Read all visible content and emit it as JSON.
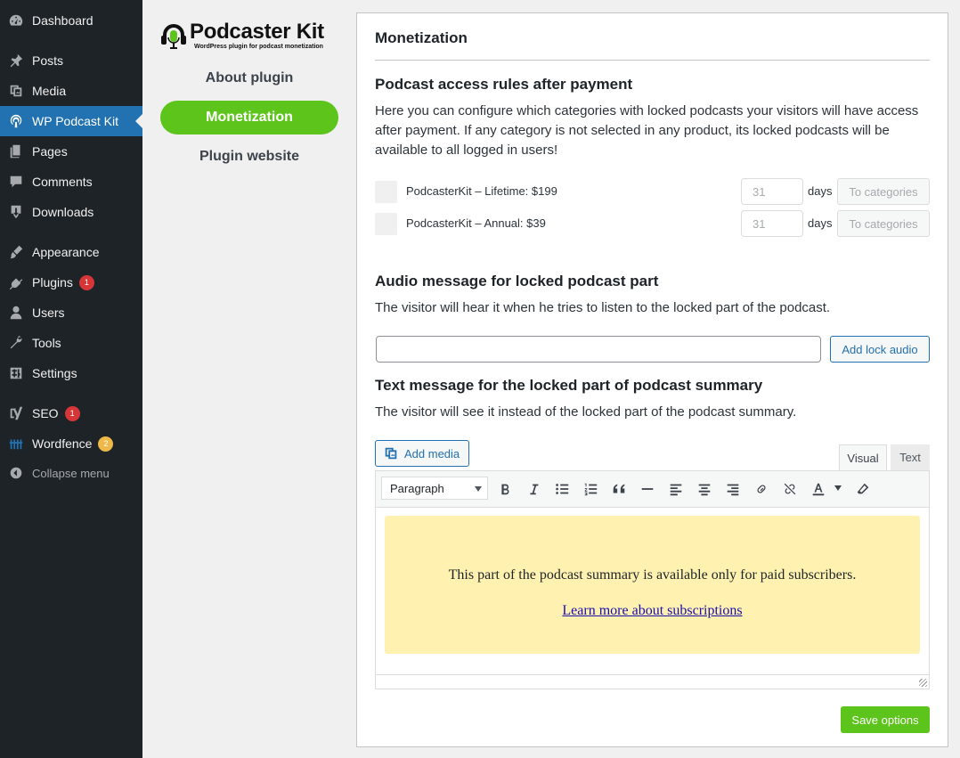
{
  "sidebar": {
    "items": [
      {
        "label": "Dashboard",
        "icon": "dashboard-icon"
      },
      {
        "label": "Posts",
        "icon": "pin-icon"
      },
      {
        "label": "Media",
        "icon": "media-icon"
      },
      {
        "label": "WP Podcast Kit",
        "icon": "podcast-icon",
        "current": true
      },
      {
        "label": "Pages",
        "icon": "pages-icon"
      },
      {
        "label": "Comments",
        "icon": "comments-icon"
      },
      {
        "label": "Downloads",
        "icon": "downloads-icon"
      },
      {
        "label": "Appearance",
        "icon": "appearance-icon"
      },
      {
        "label": "Plugins",
        "icon": "plugins-icon",
        "badge": "1"
      },
      {
        "label": "Users",
        "icon": "users-icon"
      },
      {
        "label": "Tools",
        "icon": "tools-icon"
      },
      {
        "label": "Settings",
        "icon": "settings-icon"
      },
      {
        "label": "SEO",
        "icon": "yoast-icon",
        "badge": "1"
      },
      {
        "label": "Wordfence",
        "icon": "wordfence-icon",
        "badge": "2"
      }
    ],
    "collapse_label": "Collapse menu"
  },
  "plugin_nav": {
    "logo_title": "Podcaster Kit",
    "logo_subtitle": "WordPress plugin for podcast monetization",
    "links": [
      "About plugin",
      "Monetization",
      "Plugin website"
    ],
    "active": "Monetization"
  },
  "panel": {
    "title": "Monetization",
    "access": {
      "heading": "Podcast access rules after payment",
      "description": "Here you can configure which categories with locked podcasts your visitors will have access after payment. If any category is not selected in any product, its locked podcasts will be available to all logged in users!",
      "products": [
        {
          "label": "PodcasterKit – Lifetime: $199",
          "days_placeholder": "31",
          "days_label": "days",
          "button": "To categories"
        },
        {
          "label": "PodcasterKit – Annual: $39",
          "days_placeholder": "31",
          "days_label": "days",
          "button": "To categories"
        }
      ]
    },
    "audio": {
      "heading": "Audio message for locked podcast part",
      "description": "The visitor will hear it when he tries to listen to the locked part of the podcast.",
      "input_value": "",
      "button": "Add lock audio"
    },
    "text_message": {
      "heading": "Text message for the locked part of podcast summary",
      "description": "The visitor will see it instead of the locked part of the podcast summary.",
      "add_media": "Add media",
      "tab_visual": "Visual",
      "tab_text": "Text",
      "format": "Paragraph",
      "locked_text": "This part of the podcast summary is available only for paid subscribers.",
      "locked_link": "Learn more about subscriptions"
    },
    "save_button": "Save options"
  },
  "colors": {
    "sidebar_bg": "#1d2327",
    "sidebar_current": "#2271b1",
    "accent_green": "#5cc41b",
    "locked_box_bg": "#fff2b0",
    "badge_red": "#d63638",
    "badge_yellow": "#f0b849"
  }
}
